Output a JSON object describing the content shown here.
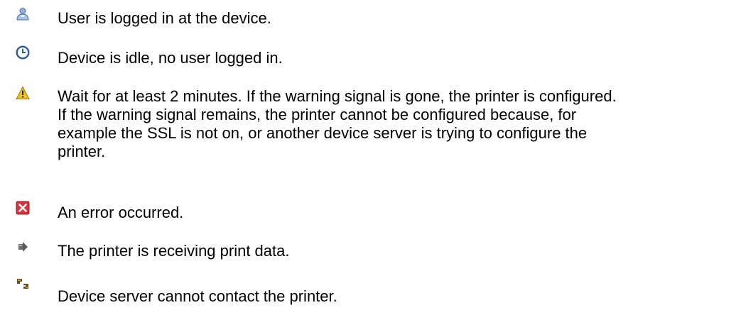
{
  "legend": {
    "items": [
      {
        "icon": "user-icon",
        "lines": [
          "User is logged in at the device."
        ]
      },
      {
        "icon": "clock-icon",
        "lines": [
          "Device is idle, no user logged in."
        ]
      },
      {
        "icon": "warning-icon",
        "lines": [
          "Wait for at least 2 minutes. If the warning signal is gone, the printer is configured.",
          "If the warning signal remains, the printer cannot be configured because, for",
          "example the SSL is not on, or another device server is trying to configure the",
          "printer."
        ]
      },
      {
        "icon": "error-icon",
        "lines": [
          "An error occurred."
        ]
      },
      {
        "icon": "receiving-data-icon",
        "lines": [
          "The printer is receiving print data."
        ]
      },
      {
        "icon": "disconnected-icon",
        "lines": [
          "Device server cannot contact the printer."
        ]
      }
    ]
  }
}
